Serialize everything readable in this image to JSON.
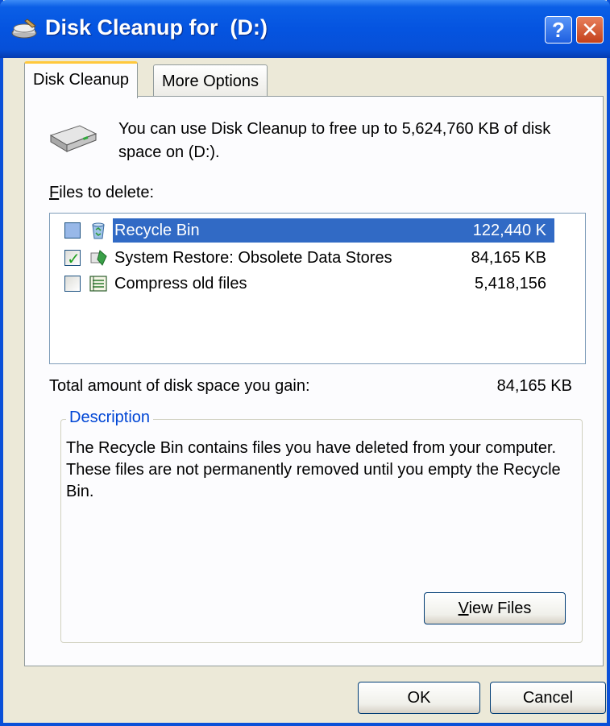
{
  "window": {
    "title": "Disk Cleanup for  (D:)",
    "help_label": "?",
    "close_label": "✕"
  },
  "tabs": [
    {
      "label": "Disk Cleanup",
      "active": true
    },
    {
      "label": "More Options",
      "active": false
    }
  ],
  "intro_text": "You can use Disk Cleanup to free up to 5,624,760 KB of disk space on  (D:).",
  "files_label_rest": "iles to delete:",
  "files_label_mnemonic": "F",
  "files": [
    {
      "name": "Recycle Bin",
      "size": "122,440 K",
      "checked": false,
      "selected": true,
      "icon": "recycle-bin-icon"
    },
    {
      "name": "System Restore: Obsolete Data Stores",
      "size": "84,165 KB",
      "checked": true,
      "selected": false,
      "icon": "system-restore-icon"
    },
    {
      "name": "Compress old files",
      "size": "5,418,156",
      "checked": false,
      "selected": false,
      "icon": "compress-files-icon"
    }
  ],
  "total": {
    "label": "Total amount of disk space you gain:",
    "value": "84,165 KB"
  },
  "description": {
    "title": "Description",
    "text": "The Recycle Bin contains files you have deleted from your computer. These files are not permanently removed until you empty the Recycle Bin."
  },
  "buttons": {
    "view_files_mnemonic": "V",
    "view_files_rest": "iew Files",
    "ok": "OK",
    "cancel": "Cancel"
  },
  "colors": {
    "title_bar": "#0554e0",
    "selection": "#316ac5",
    "group_title": "#0046d5",
    "dialog_bg": "#ece9d8"
  }
}
